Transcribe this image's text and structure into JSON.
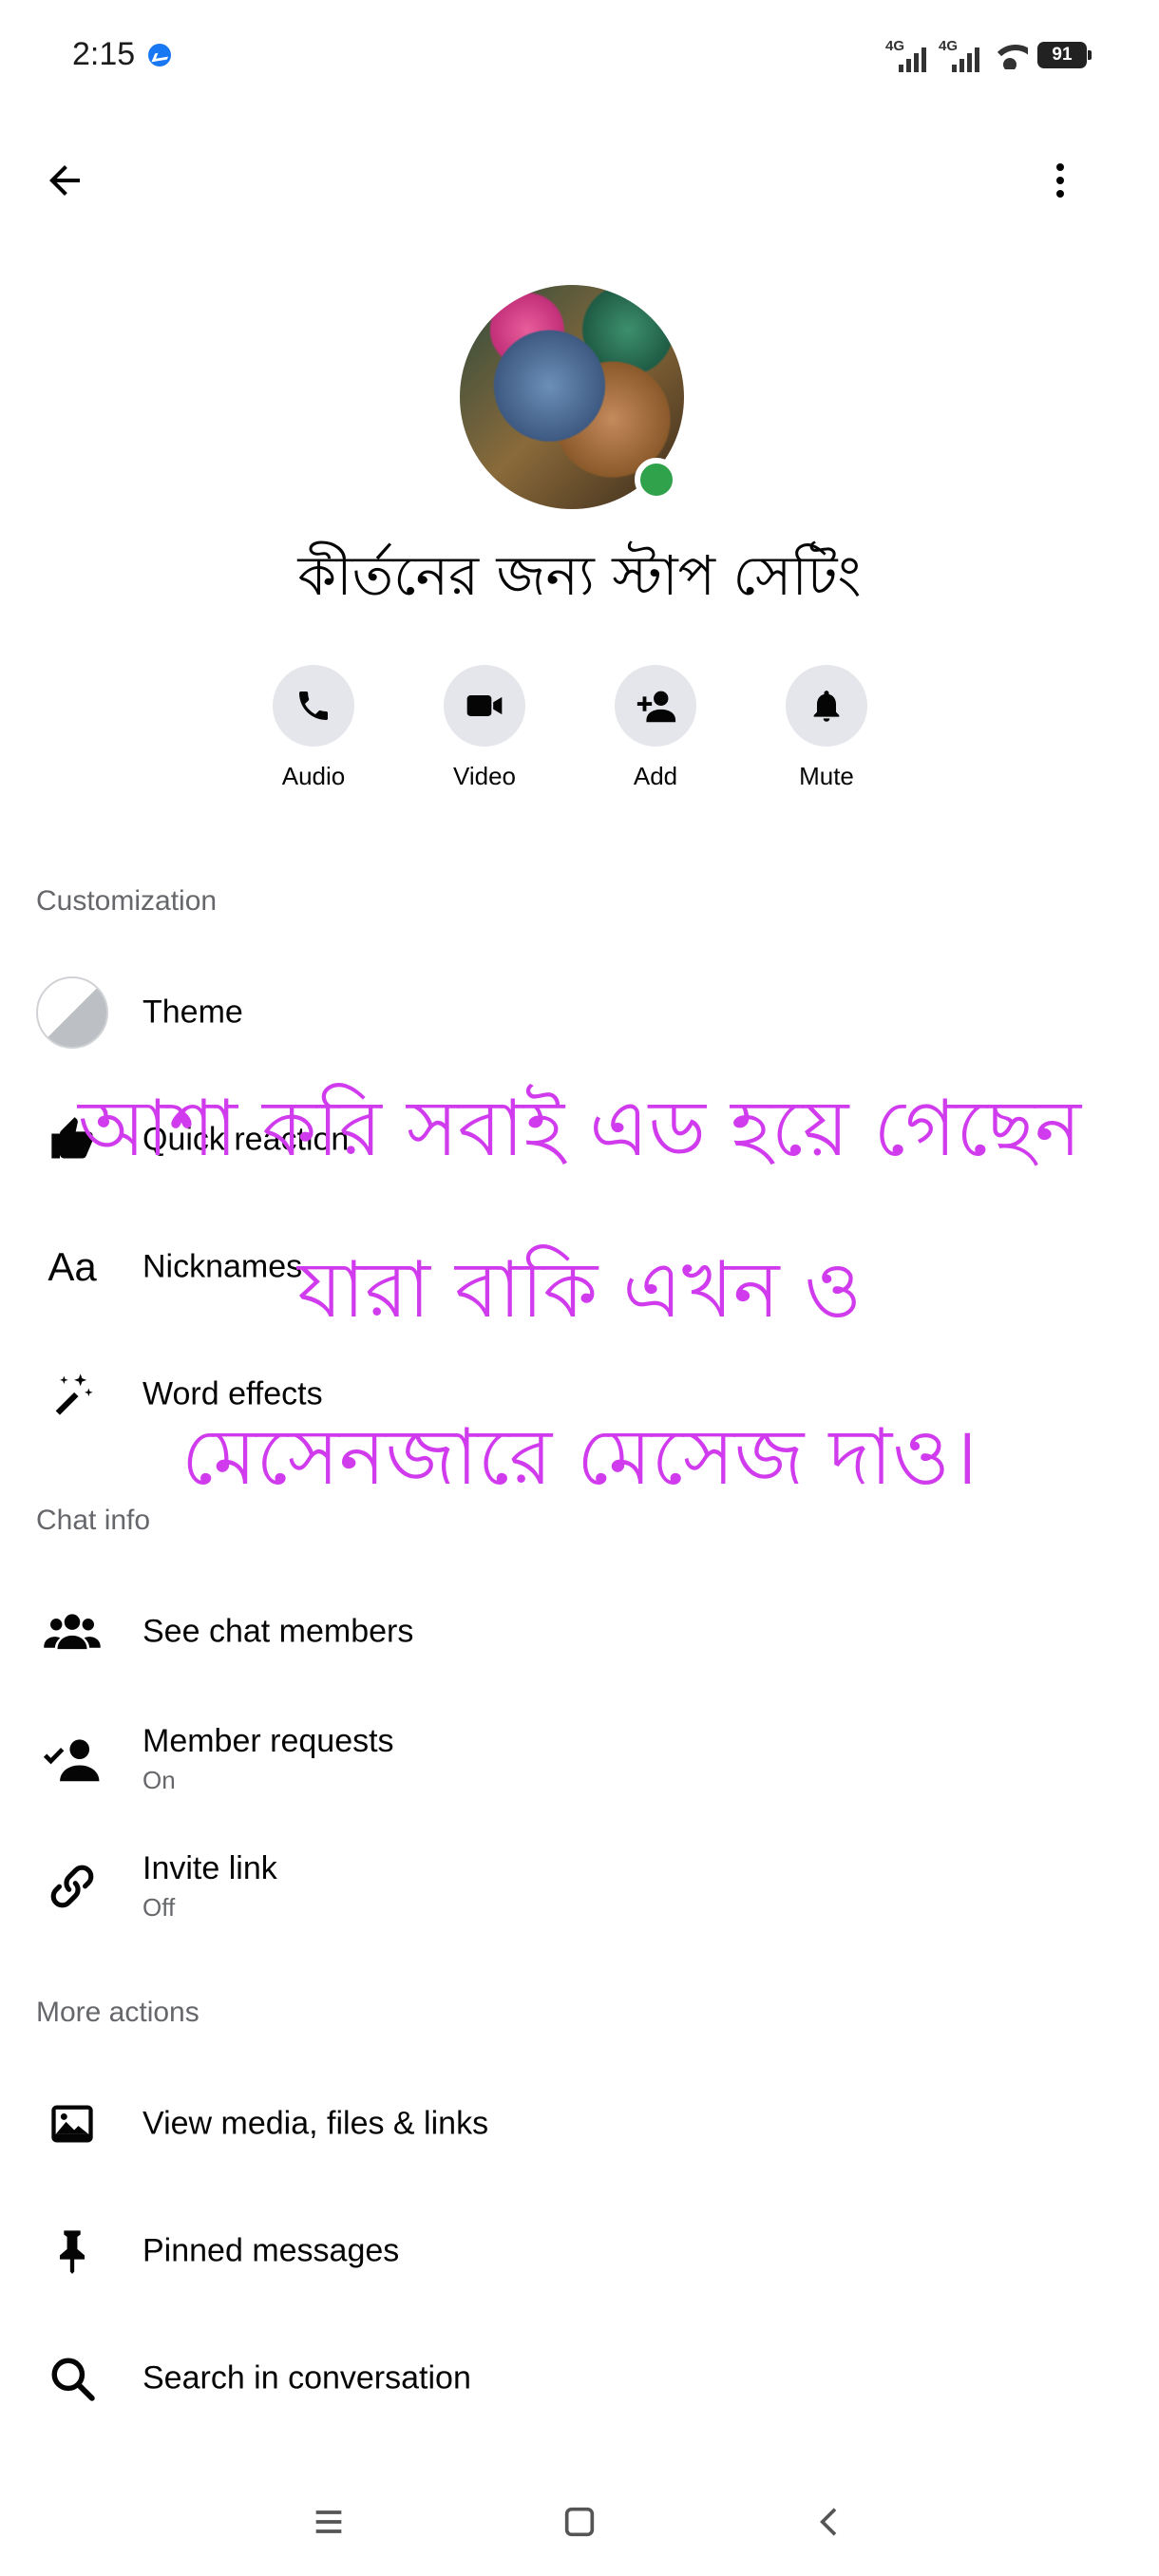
{
  "status_bar": {
    "time": "2:15",
    "network_1": "4G",
    "network_2": "4G",
    "battery": "91"
  },
  "header": {
    "back_icon": "arrow-left-icon",
    "menu_icon": "more-vertical-icon"
  },
  "group": {
    "name": "কীর্তনের জন্য স্টাপ সেটিং",
    "online": true,
    "online_color": "#31a24c"
  },
  "actions": [
    {
      "label": "Audio",
      "icon": "phone-icon"
    },
    {
      "label": "Video",
      "icon": "video-camera-icon"
    },
    {
      "label": "Add",
      "icon": "add-person-icon"
    },
    {
      "label": "Mute",
      "icon": "bell-icon"
    }
  ],
  "customization": {
    "title": "Customization",
    "items": [
      {
        "label": "Theme",
        "icon": "theme-icon"
      },
      {
        "label": "Quick reaction",
        "icon": "like-icon"
      },
      {
        "label": "Nicknames",
        "icon": "aa-icon"
      },
      {
        "label": "Word effects",
        "icon": "sparkle-wand-icon"
      }
    ]
  },
  "chat_info": {
    "title": "Chat info",
    "items": [
      {
        "label": "See chat members",
        "sub": "",
        "icon": "people-icon"
      },
      {
        "label": "Member requests",
        "sub": "On",
        "icon": "person-check-icon"
      },
      {
        "label": "Invite link",
        "sub": "Off",
        "icon": "link-icon"
      }
    ]
  },
  "more_actions": {
    "title": "More actions",
    "items": [
      {
        "label": "View media, files & links",
        "icon": "image-icon"
      },
      {
        "label": "Pinned messages",
        "icon": "pin-icon"
      },
      {
        "label": "Search in conversation",
        "icon": "search-icon"
      }
    ]
  },
  "overlay_text": {
    "line1": "আশা করি সবাই এড হয়ে গেছেন",
    "line2": "যারা বাকি এখন ও",
    "line3": "মেসেনজারে মেসেজ দাও।",
    "color": "#d13bee"
  },
  "nav_bar": {
    "recents_icon": "menu-lines-icon",
    "home_icon": "square-icon",
    "back_icon": "chevron-left-icon"
  }
}
